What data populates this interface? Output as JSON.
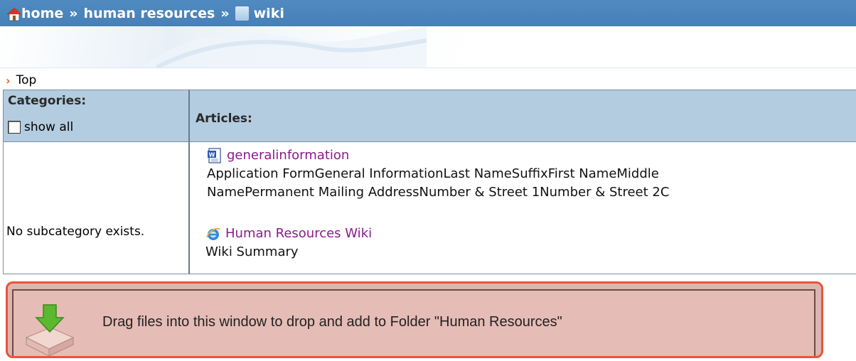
{
  "header": {
    "breadcrumb": [
      "home",
      "human resources",
      "wiki"
    ],
    "separator": "»",
    "home_icon": "home-icon",
    "wiki_icon": "wiki-icon"
  },
  "topnav": {
    "label": "Top",
    "icon": "chevron-right-icon"
  },
  "table": {
    "categories_header": "Categories:",
    "show_all_label": "show all",
    "show_all_checked": false,
    "articles_header": "Articles:",
    "no_subcategory": "No subcategory exists.",
    "articles": [
      {
        "icon": "word-document-icon",
        "title": "generalinformation",
        "summary_line1": "Application FormGeneral InformationLast NameSuffixFirst NameMiddle",
        "summary_line2": "NamePermanent Mailing AddressNumber & Street 1Number & Street 2C"
      },
      {
        "icon": "internet-explorer-icon",
        "title": "Human Resources Wiki",
        "summary_line1": "Wiki Summary"
      }
    ]
  },
  "dropzone": {
    "text": "Drag files into this window to drop and add to Folder \"Human Resources\"",
    "icon": "download-tray-icon"
  },
  "colors": {
    "header_bg": "#4780b8",
    "table_header_bg": "#b4cce0",
    "link": "#8b1a8b",
    "dropzone_border": "#e8543a",
    "dropzone_bg": "#dcb5b0"
  }
}
